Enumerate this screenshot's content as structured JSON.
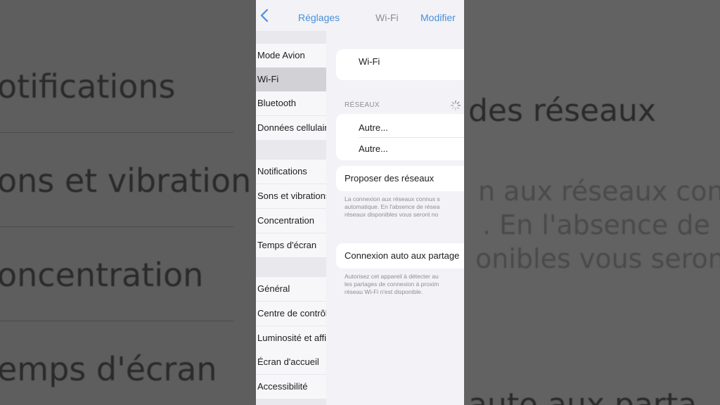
{
  "nav": {
    "back_label": "Réglages",
    "title": "Wi-Fi",
    "edit_label": "Modifier"
  },
  "sidebar": {
    "items": [
      {
        "label": "Mode Avion"
      },
      {
        "label": "Wi-Fi",
        "selected": true
      },
      {
        "label": "Bluetooth"
      },
      {
        "label": "Données cellulaires"
      },
      {
        "label": "Notifications"
      },
      {
        "label": "Sons et vibrations"
      },
      {
        "label": "Concentration"
      },
      {
        "label": "Temps d'écran"
      },
      {
        "label": "Général"
      },
      {
        "label": "Centre de contrôle"
      },
      {
        "label": "Luminosité et affichage"
      },
      {
        "label": "Écran d'accueil"
      },
      {
        "label": "Accessibilité"
      }
    ]
  },
  "detail": {
    "wifi_row_label": "Wi-Fi",
    "networks_header": "RÉSEAUX",
    "other_1": "Autre...",
    "other_2": "Autre...",
    "ask_join_label": "Proposer des réseaux",
    "ask_join_footer_1": "La connexion aux réseaux connus s",
    "ask_join_footer_2": "automatique. En l'absence de résea",
    "ask_join_footer_3": "réseaux disponibles vous seront no",
    "auto_hotspot_label": "Connexion auto aux partage",
    "auto_hotspot_footer_1": "Autorisez cet appareil à détecter au",
    "auto_hotspot_footer_2": "les partages de connexion à proxim",
    "auto_hotspot_footer_3": "réseau Wi-Fi n'est disponible."
  },
  "background": {
    "left": [
      "otifications",
      "ons et vibration",
      "oncentration",
      "emps d'écran"
    ],
    "right": [
      "des réseaux",
      "n aux réseaux connu",
      ". En l'absence de rés",
      "onibles vous seront",
      "auto aux parta"
    ]
  },
  "colors": {
    "accent": "#4a90d9",
    "page_bg": "#f2f2f7",
    "selected_row": "#d1d1d6"
  }
}
